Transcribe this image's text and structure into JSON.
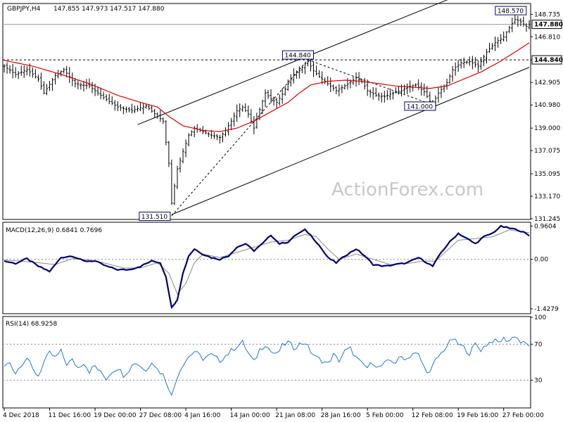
{
  "header": {
    "symbol": "GBPJPY,H4",
    "ohlc": "147.855 147.973 147.517 147.880"
  },
  "watermark": "ActionForex.com",
  "colors": {
    "price": "#000000",
    "ma": "#d80000",
    "macd": "#00006e",
    "signal": "#888888",
    "rsi": "#1e78d2",
    "grid": "#888888"
  },
  "price_panel": {
    "ylim": [
      131.245,
      149.6
    ],
    "ticks": [
      "148.735",
      "146.810",
      "144.840",
      "142.905",
      "140.980",
      "139.000",
      "137.075",
      "135.095",
      "133.170",
      "131.245"
    ],
    "tick_values": [
      148.735,
      146.81,
      144.84,
      142.905,
      140.98,
      139.0,
      137.075,
      135.095,
      133.17,
      131.245
    ],
    "last_price": "147.880",
    "last_price_value": 147.88,
    "level_label": "144.840",
    "level_value": 144.84,
    "annotations": [
      {
        "text": "144.840",
        "value": 144.84,
        "bar": 107
      },
      {
        "text": "131.510",
        "value": 131.51,
        "bar": 59
      },
      {
        "text": "141.000",
        "value": 141.0,
        "bar": 151
      },
      {
        "text": "148.570",
        "value": 148.57,
        "bar": 180
      }
    ]
  },
  "macd_panel": {
    "title": "MACD(12,26,9) 0.6841 0.7696",
    "ylim": [
      -1.55,
      1.05
    ],
    "ticks": [
      "0.9604",
      "0.00",
      "-1.4279"
    ],
    "tick_values": [
      0.9604,
      0.0,
      -1.4279
    ]
  },
  "rsi_panel": {
    "title": "RSI(14) 68.9258",
    "ylim": [
      0,
      100
    ],
    "ticks": [
      "100",
      "70",
      "30",
      "0"
    ],
    "tick_values": [
      100,
      70,
      30,
      0
    ]
  },
  "x_axis": {
    "labels": [
      "4 Dec 2018",
      "11 Dec 16:00",
      "19 Dec 00:00",
      "27 Dec 08:00",
      "4 Jan 16:00",
      "14 Jan 00:00",
      "21 Jan 08:00",
      "28 Jan 16:00",
      "5 Feb 00:00",
      "12 Feb 08:00",
      "19 Feb 16:00",
      "27 Feb 00:00"
    ],
    "label_bars": [
      0,
      16,
      32,
      48,
      64,
      80,
      96,
      112,
      128,
      144,
      160,
      176
    ]
  },
  "chart_data": {
    "type": "line",
    "title": "GBPJPY,H4",
    "bar_count": 186,
    "close_anchors": [
      [
        0,
        144.3
      ],
      [
        4,
        143.6
      ],
      [
        8,
        144.0
      ],
      [
        12,
        143.2
      ],
      [
        14,
        142.0
      ],
      [
        18,
        143.5
      ],
      [
        21,
        144.0
      ],
      [
        25,
        142.8
      ],
      [
        30,
        142.6
      ],
      [
        35,
        141.6
      ],
      [
        40,
        140.8
      ],
      [
        45,
        140.5
      ],
      [
        50,
        140.9
      ],
      [
        54,
        140.0
      ],
      [
        56,
        139.6
      ],
      [
        58,
        136.0
      ],
      [
        59,
        132.6
      ],
      [
        61,
        135.5
      ],
      [
        63,
        137.0
      ],
      [
        65,
        138.4
      ],
      [
        67,
        139.0
      ],
      [
        70,
        138.7
      ],
      [
        73,
        138.4
      ],
      [
        76,
        138.2
      ],
      [
        78,
        138.8
      ],
      [
        80,
        139.6
      ],
      [
        82,
        140.5
      ],
      [
        84,
        140.8
      ],
      [
        86,
        140.2
      ],
      [
        88,
        139.0
      ],
      [
        90,
        140.6
      ],
      [
        92,
        142.0
      ],
      [
        94,
        141.5
      ],
      [
        96,
        141.2
      ],
      [
        98,
        141.9
      ],
      [
        100,
        142.8
      ],
      [
        102,
        143.6
      ],
      [
        104,
        143.9
      ],
      [
        106,
        144.5
      ],
      [
        107,
        144.7
      ],
      [
        109,
        143.9
      ],
      [
        111,
        143.4
      ],
      [
        114,
        142.8
      ],
      [
        117,
        142.2
      ],
      [
        120,
        142.6
      ],
      [
        124,
        143.3
      ],
      [
        126,
        143.0
      ],
      [
        128,
        142.2
      ],
      [
        131,
        141.8
      ],
      [
        134,
        141.7
      ],
      [
        137,
        142.0
      ],
      [
        140,
        142.2
      ],
      [
        142,
        142.5
      ],
      [
        145,
        142.7
      ],
      [
        148,
        142.1
      ],
      [
        150,
        141.3
      ],
      [
        151,
        141.1
      ],
      [
        153,
        142.0
      ],
      [
        156,
        142.9
      ],
      [
        158,
        144.0
      ],
      [
        161,
        144.6
      ],
      [
        164,
        144.7
      ],
      [
        167,
        144.3
      ],
      [
        170,
        145.5
      ],
      [
        173,
        146.3
      ],
      [
        176,
        146.8
      ],
      [
        178,
        147.6
      ],
      [
        180,
        148.3
      ],
      [
        182,
        148.1
      ],
      [
        184,
        147.7
      ],
      [
        185,
        147.88
      ]
    ],
    "moving_average": [
      [
        0,
        144.8
      ],
      [
        10,
        144.3
      ],
      [
        20,
        143.6
      ],
      [
        30,
        142.8
      ],
      [
        40,
        141.8
      ],
      [
        48,
        141.2
      ],
      [
        54,
        140.8
      ],
      [
        58,
        140.0
      ],
      [
        63,
        139.2
      ],
      [
        70,
        138.8
      ],
      [
        76,
        138.7
      ],
      [
        82,
        139.0
      ],
      [
        88,
        139.6
      ],
      [
        94,
        140.4
      ],
      [
        100,
        141.2
      ],
      [
        104,
        142.0
      ],
      [
        108,
        142.7
      ],
      [
        114,
        143.0
      ],
      [
        120,
        143.1
      ],
      [
        126,
        143.0
      ],
      [
        132,
        142.8
      ],
      [
        138,
        142.6
      ],
      [
        144,
        142.5
      ],
      [
        150,
        142.4
      ],
      [
        156,
        142.6
      ],
      [
        162,
        143.2
      ],
      [
        168,
        143.8
      ],
      [
        174,
        144.6
      ],
      [
        180,
        145.5
      ],
      [
        185,
        146.3
      ]
    ],
    "channel_upper": [
      [
        47,
        139.3
      ],
      [
        183,
        152.6
      ]
    ],
    "channel_lower": [
      [
        59,
        131.6
      ],
      [
        185,
        144.2
      ]
    ],
    "dashed_lines": [
      [
        [
          59,
          131.5
        ],
        [
          107,
          144.84
        ]
      ],
      [
        [
          107,
          144.84
        ],
        [
          151,
          141.0
        ]
      ]
    ],
    "macd": [
      [
        0,
        -0.05
      ],
      [
        4,
        -0.12
      ],
      [
        8,
        0.02
      ],
      [
        12,
        -0.2
      ],
      [
        16,
        -0.35
      ],
      [
        20,
        0.05
      ],
      [
        24,
        0.1
      ],
      [
        28,
        -0.05
      ],
      [
        32,
        -0.05
      ],
      [
        36,
        -0.2
      ],
      [
        40,
        -0.3
      ],
      [
        44,
        -0.3
      ],
      [
        48,
        -0.2
      ],
      [
        52,
        -0.05
      ],
      [
        55,
        -0.1
      ],
      [
        57,
        -0.5
      ],
      [
        59,
        -1.4
      ],
      [
        61,
        -1.15
      ],
      [
        63,
        -0.4
      ],
      [
        65,
        0.1
      ],
      [
        67,
        0.3
      ],
      [
        70,
        0.15
      ],
      [
        73,
        0.05
      ],
      [
        76,
        0.0
      ],
      [
        79,
        0.1
      ],
      [
        82,
        0.35
      ],
      [
        85,
        0.45
      ],
      [
        88,
        0.25
      ],
      [
        91,
        0.45
      ],
      [
        94,
        0.7
      ],
      [
        97,
        0.45
      ],
      [
        100,
        0.5
      ],
      [
        103,
        0.72
      ],
      [
        106,
        0.85
      ],
      [
        108,
        0.7
      ],
      [
        111,
        0.4
      ],
      [
        114,
        0.05
      ],
      [
        117,
        -0.1
      ],
      [
        120,
        0.1
      ],
      [
        124,
        0.3
      ],
      [
        127,
        0.1
      ],
      [
        130,
        -0.15
      ],
      [
        134,
        -0.2
      ],
      [
        138,
        -0.15
      ],
      [
        142,
        -0.1
      ],
      [
        146,
        0.05
      ],
      [
        149,
        -0.1
      ],
      [
        151,
        -0.2
      ],
      [
        154,
        0.2
      ],
      [
        157,
        0.5
      ],
      [
        160,
        0.75
      ],
      [
        163,
        0.6
      ],
      [
        166,
        0.45
      ],
      [
        169,
        0.65
      ],
      [
        172,
        0.75
      ],
      [
        175,
        0.95
      ],
      [
        178,
        0.9
      ],
      [
        181,
        0.85
      ],
      [
        183,
        0.78
      ],
      [
        185,
        0.68
      ]
    ],
    "macd_signal": [
      [
        0,
        -0.02
      ],
      [
        6,
        -0.05
      ],
      [
        12,
        -0.1
      ],
      [
        18,
        -0.15
      ],
      [
        24,
        0.02
      ],
      [
        30,
        -0.02
      ],
      [
        36,
        -0.12
      ],
      [
        42,
        -0.25
      ],
      [
        48,
        -0.25
      ],
      [
        54,
        -0.1
      ],
      [
        58,
        -0.4
      ],
      [
        61,
        -1.0
      ],
      [
        64,
        -0.7
      ],
      [
        67,
        -0.1
      ],
      [
        70,
        0.15
      ],
      [
        76,
        0.05
      ],
      [
        82,
        0.2
      ],
      [
        88,
        0.35
      ],
      [
        94,
        0.5
      ],
      [
        100,
        0.55
      ],
      [
        106,
        0.72
      ],
      [
        110,
        0.65
      ],
      [
        114,
        0.3
      ],
      [
        118,
        0.0
      ],
      [
        124,
        0.15
      ],
      [
        130,
        0.0
      ],
      [
        136,
        -0.15
      ],
      [
        142,
        -0.12
      ],
      [
        148,
        -0.05
      ],
      [
        152,
        -0.05
      ],
      [
        156,
        0.25
      ],
      [
        160,
        0.55
      ],
      [
        166,
        0.6
      ],
      [
        172,
        0.65
      ],
      [
        178,
        0.85
      ],
      [
        185,
        0.77
      ]
    ],
    "rsi": [
      [
        0,
        45
      ],
      [
        2,
        50
      ],
      [
        4,
        38
      ],
      [
        6,
        48
      ],
      [
        8,
        55
      ],
      [
        10,
        42
      ],
      [
        12,
        35
      ],
      [
        14,
        50
      ],
      [
        16,
        60
      ],
      [
        18,
        55
      ],
      [
        20,
        62
      ],
      [
        22,
        48
      ],
      [
        24,
        52
      ],
      [
        26,
        44
      ],
      [
        28,
        50
      ],
      [
        30,
        40
      ],
      [
        32,
        46
      ],
      [
        34,
        38
      ],
      [
        36,
        32
      ],
      [
        38,
        40
      ],
      [
        40,
        44
      ],
      [
        42,
        36
      ],
      [
        44,
        42
      ],
      [
        46,
        50
      ],
      [
        48,
        46
      ],
      [
        50,
        40
      ],
      [
        52,
        52
      ],
      [
        54,
        42
      ],
      [
        56,
        36
      ],
      [
        58,
        22
      ],
      [
        59,
        12
      ],
      [
        61,
        35
      ],
      [
        63,
        48
      ],
      [
        65,
        56
      ],
      [
        67,
        62
      ],
      [
        70,
        54
      ],
      [
        73,
        58
      ],
      [
        76,
        52
      ],
      [
        79,
        60
      ],
      [
        82,
        68
      ],
      [
        84,
        72
      ],
      [
        86,
        60
      ],
      [
        88,
        50
      ],
      [
        90,
        64
      ],
      [
        92,
        70
      ],
      [
        94,
        62
      ],
      [
        96,
        58
      ],
      [
        98,
        68
      ],
      [
        100,
        72
      ],
      [
        102,
        66
      ],
      [
        104,
        70
      ],
      [
        106,
        72
      ],
      [
        108,
        62
      ],
      [
        110,
        55
      ],
      [
        112,
        52
      ],
      [
        114,
        48
      ],
      [
        116,
        58
      ],
      [
        118,
        52
      ],
      [
        120,
        62
      ],
      [
        122,
        65
      ],
      [
        124,
        55
      ],
      [
        126,
        48
      ],
      [
        128,
        44
      ],
      [
        130,
        50
      ],
      [
        132,
        44
      ],
      [
        134,
        48
      ],
      [
        136,
        52
      ],
      [
        138,
        50
      ],
      [
        140,
        56
      ],
      [
        142,
        54
      ],
      [
        144,
        60
      ],
      [
        146,
        58
      ],
      [
        148,
        44
      ],
      [
        150,
        38
      ],
      [
        152,
        52
      ],
      [
        154,
        60
      ],
      [
        156,
        68
      ],
      [
        158,
        76
      ],
      [
        160,
        70
      ],
      [
        162,
        66
      ],
      [
        164,
        60
      ],
      [
        166,
        70
      ],
      [
        168,
        64
      ],
      [
        170,
        70
      ],
      [
        172,
        74
      ],
      [
        174,
        72
      ],
      [
        176,
        76
      ],
      [
        178,
        74
      ],
      [
        180,
        80
      ],
      [
        182,
        72
      ],
      [
        184,
        70
      ],
      [
        185,
        69
      ]
    ]
  }
}
